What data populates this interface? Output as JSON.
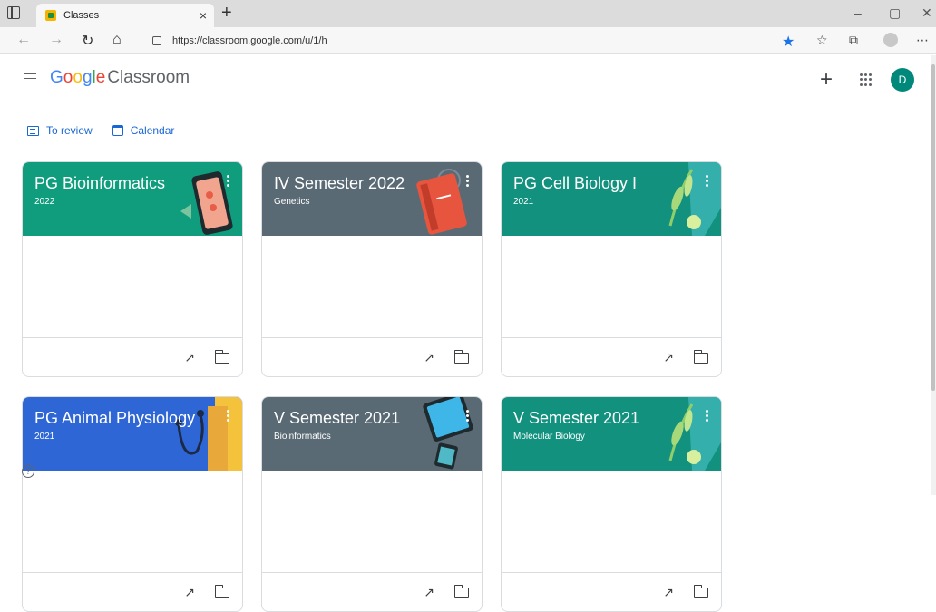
{
  "browser": {
    "tab_title": "Classes",
    "tab_close": "×",
    "new_tab": "+",
    "url": "https://classroom.google.com/u/1/h",
    "window_controls": [
      "–",
      "▢",
      "✕"
    ]
  },
  "header": {
    "logo_google": [
      "G",
      "o",
      "o",
      "g",
      "l",
      "e"
    ],
    "logo_google_colors": [
      "#4285f4",
      "#ea4335",
      "#fbbc05",
      "#4285f4",
      "#34a853",
      "#ea4335"
    ],
    "logo_product": "Classroom",
    "create_label": "+",
    "avatar_letter": "D"
  },
  "subnav": {
    "to_review": "To review",
    "calendar": "Calendar"
  },
  "classes": [
    {
      "title": "PG Bioinformatics",
      "section": "2022",
      "color": "#0f9d7e",
      "theme": "phone"
    },
    {
      "title": "IV Semester 2022",
      "section": "Genetics",
      "color": "#5a6a75",
      "theme": "book"
    },
    {
      "title": "PG Cell Biology I",
      "section": "2021",
      "color": "#13917f",
      "theme": "plant"
    },
    {
      "title": "PG Animal Physiology",
      "section": "2021",
      "color": "#2f66d6",
      "theme": "stethoscope"
    },
    {
      "title": "V Semester 2021",
      "section": "Bioinformatics",
      "color": "#5a6a75",
      "theme": "tablet"
    },
    {
      "title": "V Semester 2021",
      "section": "Molecular Biology",
      "color": "#13917f",
      "theme": "plant"
    }
  ],
  "help_label": "?"
}
